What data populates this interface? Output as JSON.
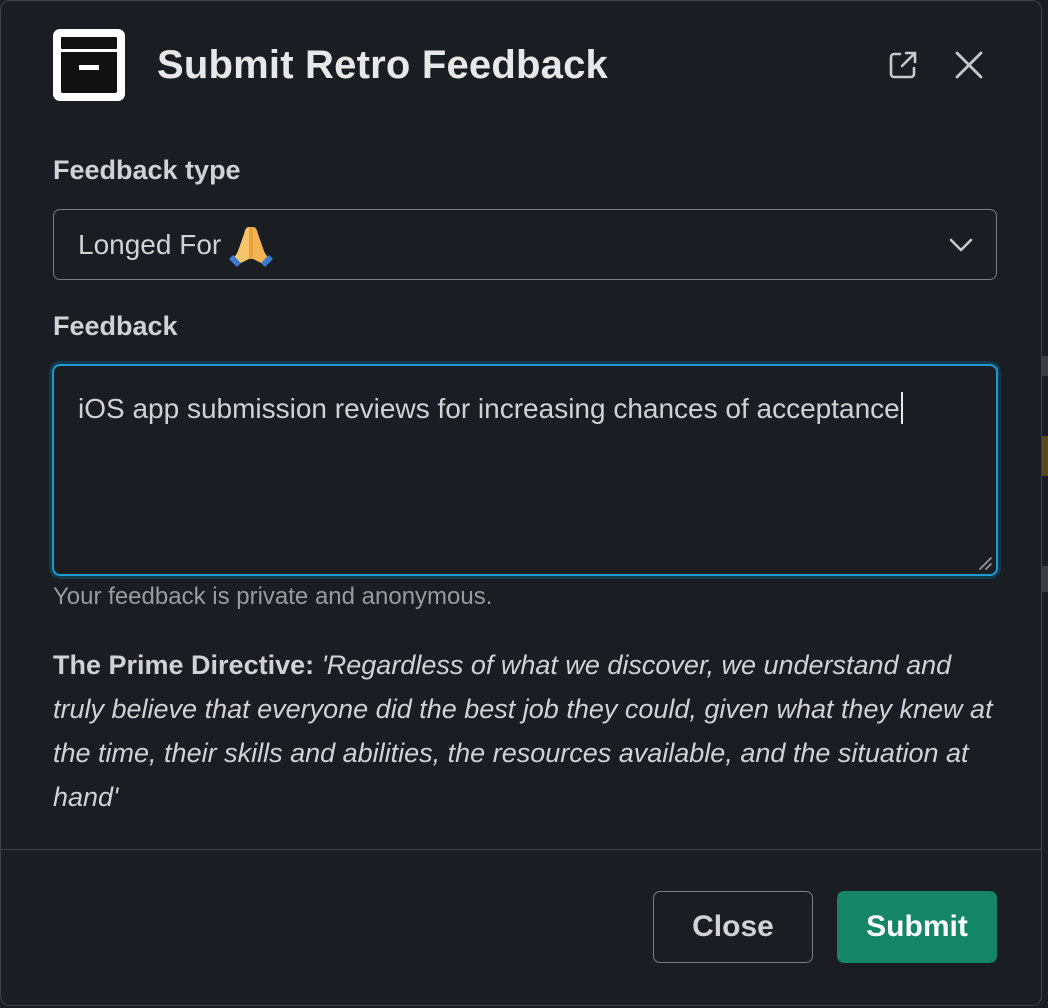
{
  "modal": {
    "title": "Submit Retro Feedback",
    "app_icon": "archive-box-icon",
    "header_actions": [
      {
        "icon": "open-in-new-window-icon"
      },
      {
        "icon": "close-icon"
      }
    ]
  },
  "feedback_type": {
    "label": "Feedback type",
    "selected_value": "Longed For",
    "selected_emoji": "folded-hands-emoji",
    "icon": "chevron-down-icon"
  },
  "feedback": {
    "label": "Feedback",
    "value": "iOS app submission reviews for increasing chances of acceptance",
    "hint": "Your feedback is private and anonymous."
  },
  "prime_directive": {
    "heading": "The Prime Directive:",
    "text": " 'Regardless of what we discover, we understand and truly believe that everyone did the best job they could, given what they knew at the time, their skills and abilities, the resources available, and the situation at hand'"
  },
  "footer": {
    "close_label": "Close",
    "submit_label": "Submit"
  },
  "colors": {
    "background": "#1a1d21",
    "focus_ring": "#1d9bd1",
    "submit": "#148567",
    "text": "#d1d2d3",
    "muted": "#9a9b9d"
  }
}
